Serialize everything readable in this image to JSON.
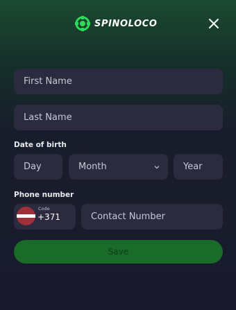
{
  "header": {
    "brand": "SPINOLOCO"
  },
  "form": {
    "first_name_placeholder": "First Name",
    "last_name_placeholder": "Last Name",
    "dob_label": "Date of birth",
    "day_placeholder": "Day",
    "month_placeholder": "Month",
    "year_placeholder": "Year",
    "phone_label": "Phone number",
    "code_label": "Code",
    "code_value": "+371",
    "contact_placeholder": "Contact Number",
    "save_label": "Save"
  },
  "colors": {
    "brand_green": "#2ddb5a",
    "save_button": "#1a6b2a",
    "field_bg": "#2b2a3f",
    "flag_red": "#9e3039"
  },
  "icons": {
    "logo": "spinoloco-logo-icon",
    "close": "close-icon",
    "chevron": "chevron-down-icon",
    "flag": "latvia-flag-icon"
  }
}
